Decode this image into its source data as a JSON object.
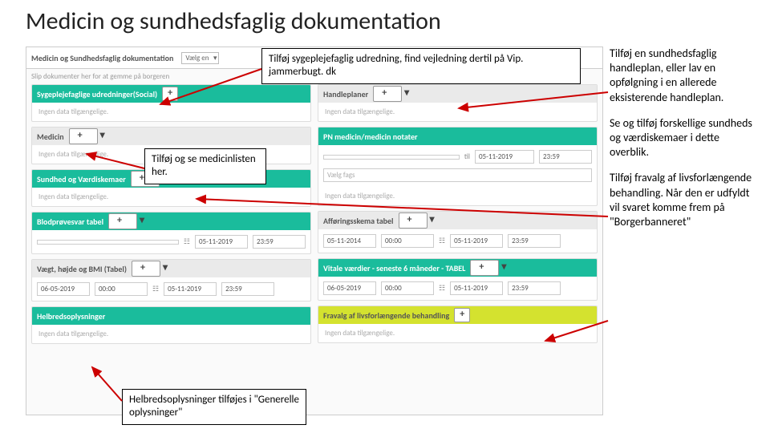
{
  "slide": {
    "title": "Medicin og sundhedsfaglig dokumentation"
  },
  "app": {
    "header": {
      "title": "Medicin og Sundhedsfaglig dokumentation",
      "dropdown": "Vælg en"
    },
    "subheader": "Slip dokumenter her for at gemme på borgeren",
    "left": {
      "sec1": {
        "title": "Sygeplejefaglige udredninger(Social)"
      },
      "nodata": "Ingen data tilgængelige.",
      "sec2": {
        "title": "Medicin"
      },
      "sec3": {
        "title": "Sundhed og Værdiskemaer"
      },
      "sec4": {
        "title": "Blodprøvesvar tabel",
        "date1": "05-11-2019",
        "time1": "23:59"
      },
      "sec5": {
        "title": "Vægt, højde og BMI (Tabel)",
        "d1": "06-05-2019",
        "t1": "00:00",
        "d2": "05-11-2019",
        "t2": "23:59"
      },
      "sec6": {
        "title": "Helbredsoplysninger"
      }
    },
    "right": {
      "sec1": {
        "title": "Handleplaner"
      },
      "nodata": "Ingen data tilgængelige.",
      "sec2": {
        "title": "PN medicin/medicin notater",
        "til": "til",
        "date": "05-11-2019",
        "time": "23:59",
        "vaelg": "Vælg fags"
      },
      "sec3": {
        "title": "Afføringsskema tabel",
        "d1": "05-11-2014",
        "t1": "00:00",
        "d2": "05-11-2019",
        "t2": "23:59"
      },
      "sec4": {
        "title": "Vitale værdier - seneste 6 måneder - TABEL",
        "d1": "06-05-2019",
        "t1": "00:00",
        "d2": "05-11-2019",
        "t2": "23:59"
      },
      "sec5": {
        "title": "Fravalg af livsforlængende behandling"
      }
    },
    "plus": "+"
  },
  "callouts": {
    "top": "Tilføj sygeplejefaglig udredning, find vejledning dertil på Vip. jammerbugt. dk",
    "mid": "Tilføj og se medicinlisten her.",
    "bottom": "Helbredsoplysninger tilføjes i \"Generelle oplysninger\""
  },
  "sidebar": {
    "p1": "Tilføj en sundhedsfaglig handleplan, eller lav en opfølgning i en allerede eksisterende handleplan.",
    "p2": "Se og tilføj forskellige sundheds og værdiskemaer i dette overblik.",
    "p3": "Tilføj fravalg af livsforlængende behandling. Når den er udfyldt vil svaret komme frem på \"Borgerbanneret\""
  }
}
